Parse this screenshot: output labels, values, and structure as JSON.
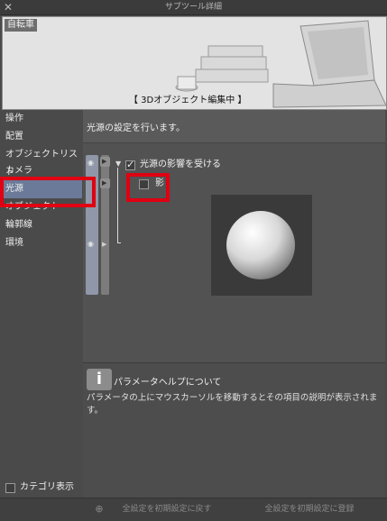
{
  "window": {
    "title": "サブツール詳細",
    "close_icon": "close-icon"
  },
  "preview": {
    "object_name": "自転車",
    "status": "【 3Dオブジェクト編集中 】"
  },
  "sidebar": {
    "items": [
      {
        "label": "操作"
      },
      {
        "label": "配置"
      },
      {
        "label": "オブジェクトリスト"
      },
      {
        "label": "カメラ"
      },
      {
        "label": "光源",
        "selected": true
      },
      {
        "label": "オブジェクト"
      },
      {
        "label": "輪郭線"
      },
      {
        "label": "環境"
      }
    ],
    "category_toggle_label": "カテゴリ表示"
  },
  "panel": {
    "description": "光源の設定を行います。",
    "light_affect_label": "光源の影響を受ける",
    "light_affect_checked": true,
    "shadow_label": "影",
    "shadow_checked": false
  },
  "help": {
    "title": "パラメータヘルプについて",
    "body": "パラメータの上にマウスカーソルを移動するとその項目の説明が表示されます。"
  },
  "bottom": {
    "reset_label": "全設定を初期設定に戻す",
    "register_label": "全設定を初期設定に登録"
  },
  "colors": {
    "selection": "#6c7a99",
    "highlight": "#e00012"
  }
}
